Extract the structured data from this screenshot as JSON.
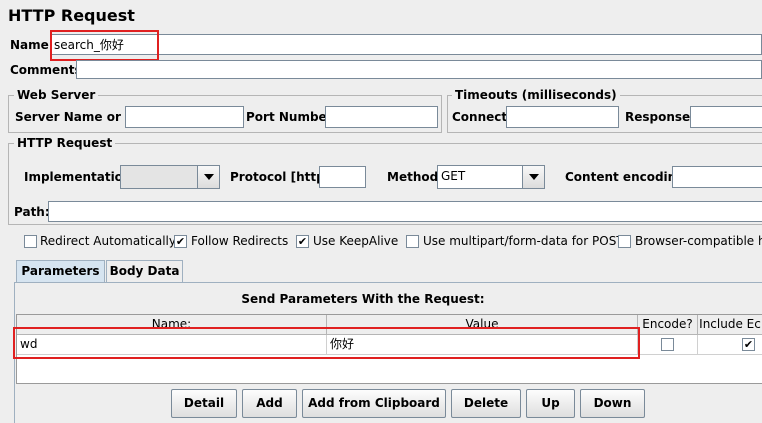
{
  "window": {
    "title": "HTTP Request"
  },
  "name_field": {
    "label": "Name:",
    "value": "search_你好"
  },
  "comments": {
    "label": "Comments:",
    "value": ""
  },
  "web_server": {
    "legend": "Web Server",
    "server_label": "Server Name or IP:",
    "server_value": "",
    "port_label": "Port Number:",
    "port_value": ""
  },
  "timeouts": {
    "legend": "Timeouts (milliseconds)",
    "connect_label": "Connect:",
    "connect_value": "",
    "response_label": "Response:",
    "response_value": ""
  },
  "http_request": {
    "legend": "HTTP Request",
    "implementation_label": "Implementation:",
    "implementation_value": "",
    "protocol_label": "Protocol [http]:",
    "protocol_value": "",
    "method_label": "Method:",
    "method_value": "GET",
    "encoding_label": "Content encoding:",
    "encoding_value": "",
    "path_label": "Path:",
    "path_value": ""
  },
  "options": [
    {
      "label": "Redirect Automatically",
      "checked": false
    },
    {
      "label": "Follow Redirects",
      "checked": true
    },
    {
      "label": "Use KeepAlive",
      "checked": true
    },
    {
      "label": "Use multipart/form-data for POST",
      "checked": false
    },
    {
      "label": "Browser-compatible he",
      "checked": false
    }
  ],
  "tabs": [
    {
      "label": "Parameters",
      "active": true
    },
    {
      "label": "Body Data",
      "active": false
    }
  ],
  "params": {
    "header": "Send Parameters With the Request:",
    "columns": [
      "Name:",
      "Value",
      "Encode?",
      "Include Ec"
    ],
    "rows": [
      {
        "name": "wd",
        "value": "你好",
        "encode": false,
        "include": true
      }
    ]
  },
  "buttons": {
    "detail": "Detail",
    "add": "Add",
    "add_clipboard": "Add from Clipboard",
    "delete": "Delete",
    "up": "Up",
    "down": "Down"
  },
  "colors": {
    "highlight": "#e02020",
    "tab_active": "#d6e4f0",
    "background": "#eeeeee"
  }
}
